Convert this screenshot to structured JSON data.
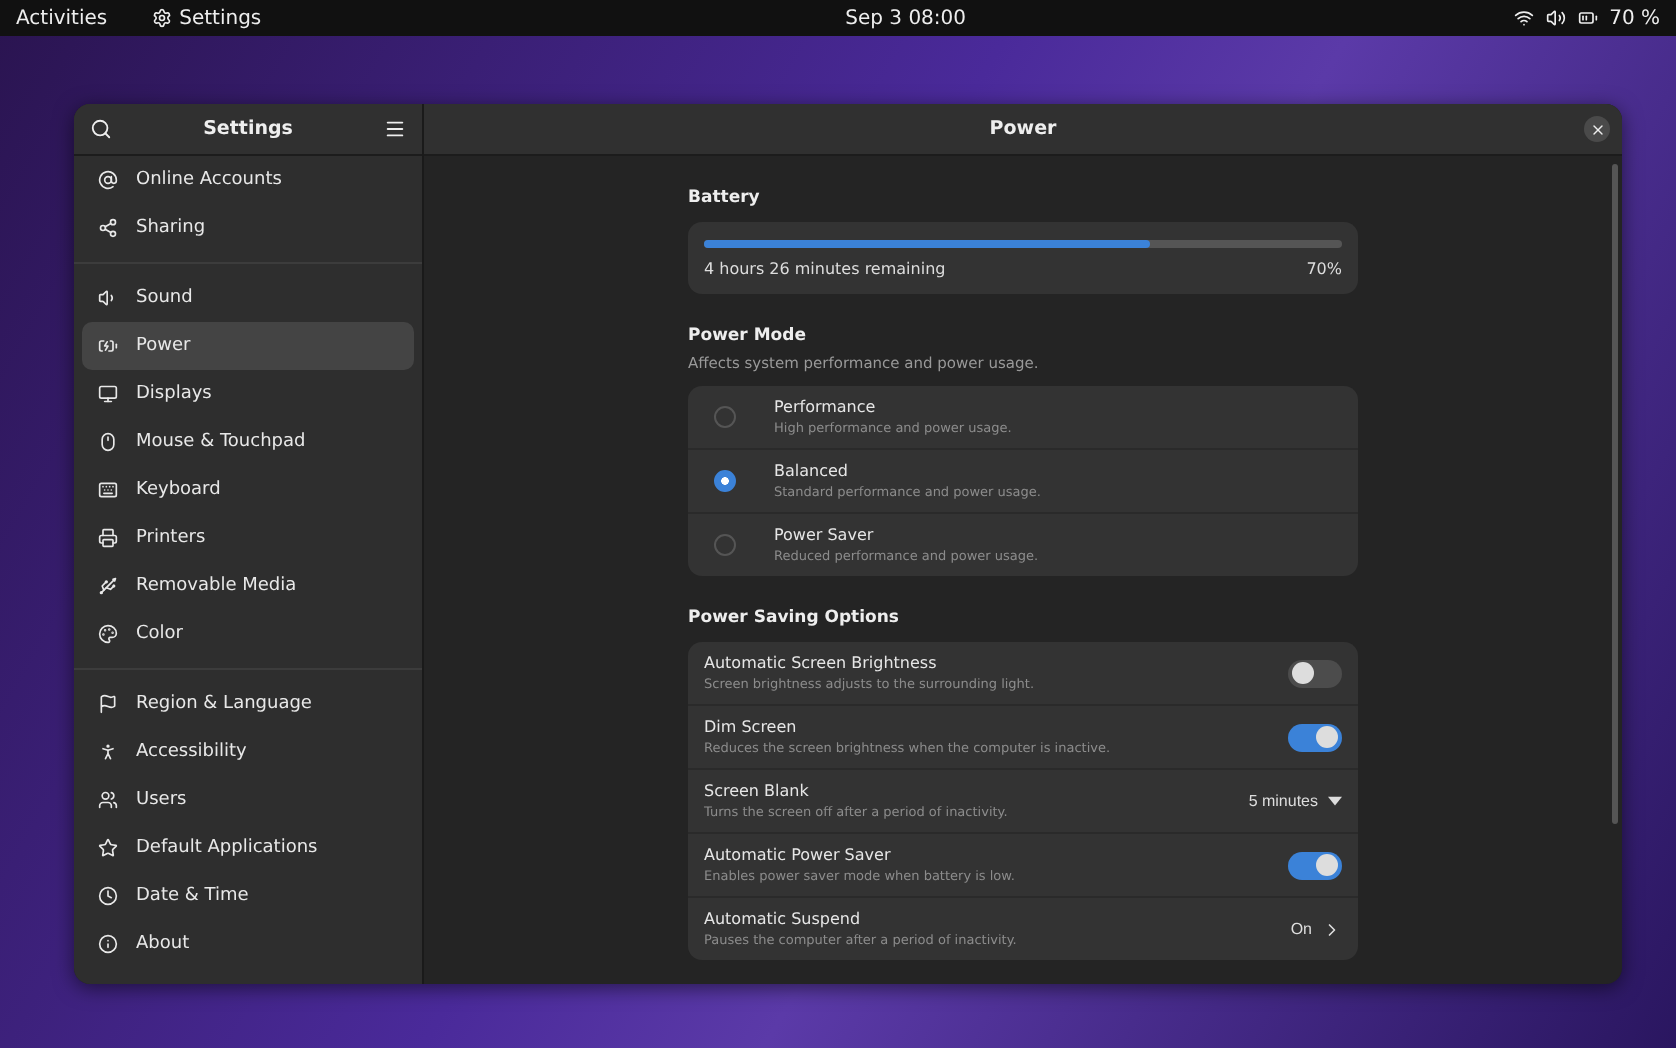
{
  "top_bar": {
    "activities": "Activities",
    "app": "Settings",
    "clock": "Sep 3  08:00",
    "battery": "70 %"
  },
  "sidebar": {
    "title": "Settings",
    "groups": [
      [
        {
          "label": "Online Accounts",
          "selected": false
        },
        {
          "label": "Sharing",
          "selected": false
        }
      ],
      [
        {
          "label": "Sound",
          "selected": false
        },
        {
          "label": "Power",
          "selected": true
        },
        {
          "label": "Displays",
          "selected": false
        },
        {
          "label": "Mouse & Touchpad",
          "selected": false
        },
        {
          "label": "Keyboard",
          "selected": false
        },
        {
          "label": "Printers",
          "selected": false
        },
        {
          "label": "Removable Media",
          "selected": false
        },
        {
          "label": "Color",
          "selected": false
        }
      ],
      [
        {
          "label": "Region & Language",
          "selected": false
        },
        {
          "label": "Accessibility",
          "selected": false
        },
        {
          "label": "Users",
          "selected": false
        },
        {
          "label": "Default Applications",
          "selected": false
        },
        {
          "label": "Date & Time",
          "selected": false
        },
        {
          "label": "About",
          "selected": false
        }
      ]
    ]
  },
  "page": {
    "title": "Power",
    "battery": {
      "heading": "Battery",
      "level": 0.7,
      "remaining": "4 hours 26 minutes remaining",
      "percent": "70%"
    },
    "power_mode": {
      "heading": "Power Mode",
      "subtitle": "Affects system performance and power usage.",
      "options": [
        {
          "title": "Performance",
          "subtitle": "High performance and power usage.",
          "selected": false
        },
        {
          "title": "Balanced",
          "subtitle": "Standard performance and power usage.",
          "selected": true
        },
        {
          "title": "Power Saver",
          "subtitle": "Reduced performance and power usage.",
          "selected": false
        }
      ]
    },
    "saving": {
      "heading": "Power Saving Options",
      "rows": [
        {
          "kind": "toggle",
          "title": "Automatic Screen Brightness",
          "subtitle": "Screen brightness adjusts to the surrounding light.",
          "on": false
        },
        {
          "kind": "toggle",
          "title": "Dim Screen",
          "subtitle": "Reduces the screen brightness when the computer is inactive.",
          "on": true
        },
        {
          "kind": "dropdown",
          "title": "Screen Blank",
          "subtitle": "Turns the screen off after a period of inactivity.",
          "value": "5 minutes"
        },
        {
          "kind": "toggle",
          "title": "Automatic Power Saver",
          "subtitle": "Enables power saver mode when battery is low.",
          "on": true
        },
        {
          "kind": "link",
          "title": "Automatic Suspend",
          "subtitle": "Pauses the computer after a period of inactivity.",
          "value": "On"
        }
      ]
    }
  }
}
